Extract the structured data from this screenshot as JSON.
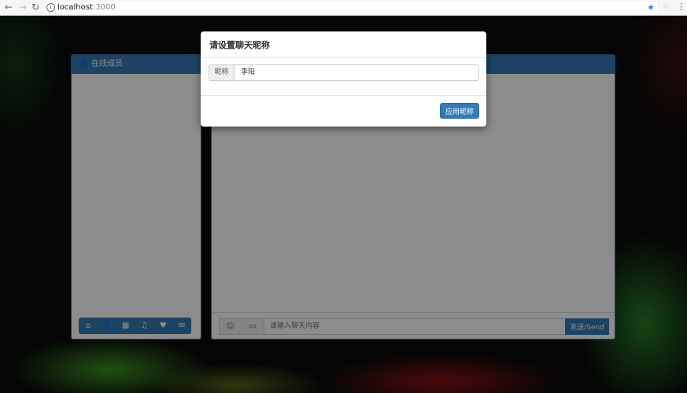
{
  "browser": {
    "url_host": "localhost",
    "url_port": ":3000",
    "icons": {
      "back": "arrow-left-icon",
      "forward": "arrow-right-icon",
      "reload": "reload-icon",
      "info": "info-icon",
      "star": "star-icon",
      "menu": "kebab-menu-icon"
    },
    "glyphs": {
      "back": "←",
      "forward": "→",
      "reload": "↻",
      "info": "i",
      "star": "★",
      "ext": "◇",
      "menu": "⋮"
    }
  },
  "users_panel": {
    "title": "在线成员",
    "title_icon": "user-icon",
    "title_icon_glyph": "👤",
    "toolbar": [
      {
        "name": "home-icon",
        "glyph": "⌂"
      },
      {
        "name": "user-icon",
        "glyph": "👤"
      },
      {
        "name": "film-icon",
        "glyph": "▦"
      },
      {
        "name": "music-icon",
        "glyph": "♫"
      },
      {
        "name": "heart-icon",
        "glyph": "♥"
      },
      {
        "name": "mail-icon",
        "glyph": "✉"
      }
    ]
  },
  "chat_panel": {
    "emoji_glyph": "☺",
    "image_glyph": "▭",
    "input_placeholder": "请输入聊天内容",
    "send_label": "发送/Send"
  },
  "modal": {
    "title": "请设置聊天昵称",
    "addon_label": "昵称",
    "nickname_value": "李阳",
    "apply_label": "应用昵称"
  },
  "colors": {
    "primary": "#337ab7",
    "overlay": "rgba(0,0,0,0.45)"
  }
}
